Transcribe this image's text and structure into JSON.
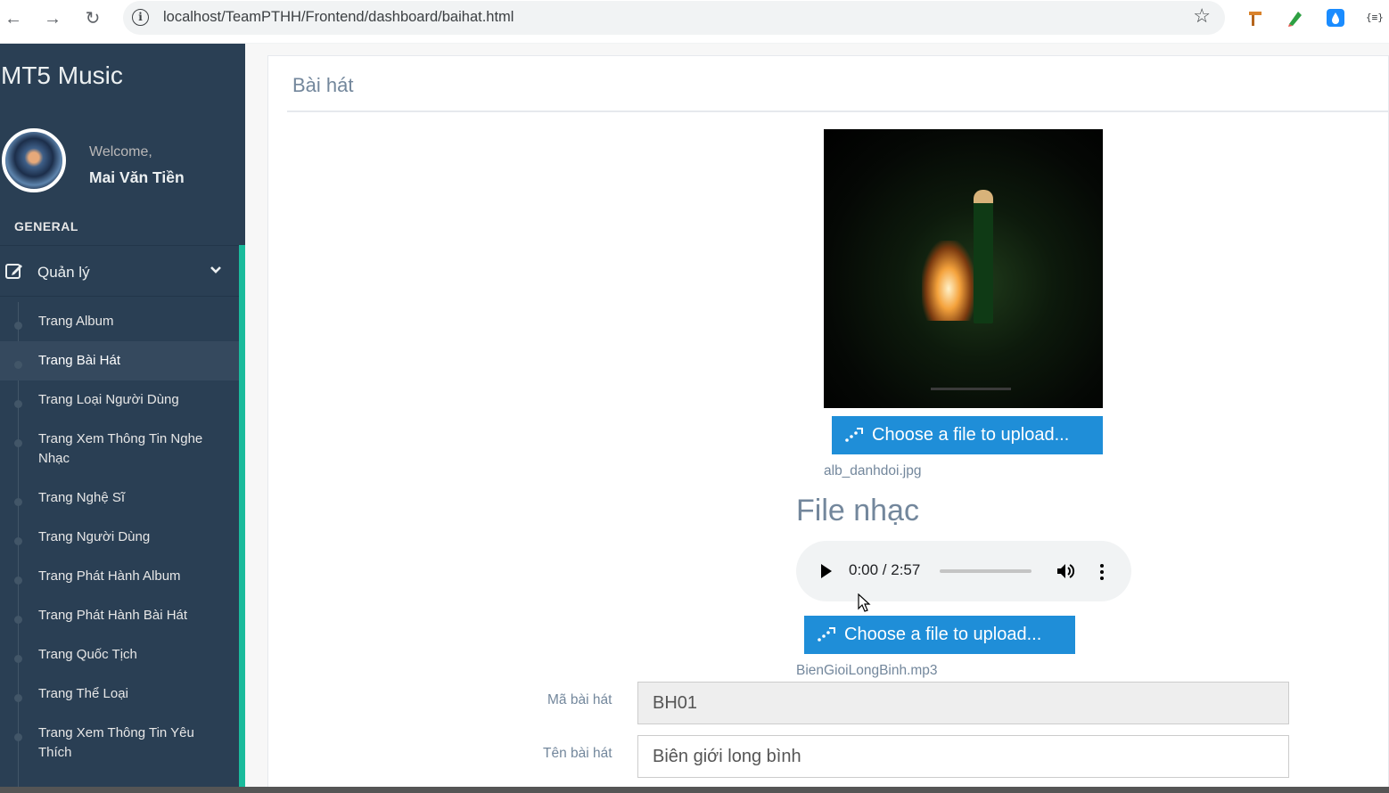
{
  "browser": {
    "url": "localhost/TeamPTHH/Frontend/dashboard/baihat.html",
    "back_glyph": "←",
    "forward_glyph": "→",
    "reload_glyph": "↻",
    "info_glyph": "i",
    "star_glyph": "☆",
    "extensions": [
      "hammer-extension-icon",
      "pen-extension-icon",
      "drop-extension-icon",
      "json-extension-icon"
    ],
    "json_ext_label": "{≡}"
  },
  "sidebar": {
    "brand": "MT5 Music",
    "welcome": "Welcome,",
    "username": "Mai Văn Tiền",
    "section": "GENERAL",
    "menu_label": "Quản lý",
    "items": [
      {
        "label": "Trang Album",
        "active": false
      },
      {
        "label": "Trang Bài Hát",
        "active": true
      },
      {
        "label": "Trang Loại Người Dùng",
        "active": false
      },
      {
        "label": "Trang Xem Thông Tin Nghe Nhạc",
        "active": false
      },
      {
        "label": "Trang Nghệ Sĩ",
        "active": false
      },
      {
        "label": "Trang Người Dùng",
        "active": false
      },
      {
        "label": "Trang Phát Hành Album",
        "active": false
      },
      {
        "label": "Trang Phát Hành Bài Hát",
        "active": false
      },
      {
        "label": "Trang Quốc Tịch",
        "active": false
      },
      {
        "label": "Trang Thể Loại",
        "active": false
      },
      {
        "label": "Trang Xem Thông Tin Yêu Thích",
        "active": false
      }
    ]
  },
  "main": {
    "title": "Bài hát",
    "image_upload_label": "Choose a file to upload...",
    "image_filename": "alb_danhdoi.jpg",
    "music_heading": "File nhạc",
    "audio_time": "0:00 / 2:57",
    "audio_progress": 0,
    "music_upload_label": "Choose a file to upload...",
    "music_filename": "BienGioiLongBinh.mp3",
    "fields": {
      "ma_label": "Mã bài hát",
      "ma_value": "BH01",
      "ten_label": "Tên bài hát",
      "ten_value": "Biên giới long bình"
    }
  },
  "colors": {
    "sidebar_bg": "#2a3f54",
    "accent": "#1abb9c",
    "button_blue": "#1f8ed8",
    "label_gray": "#73879c"
  }
}
